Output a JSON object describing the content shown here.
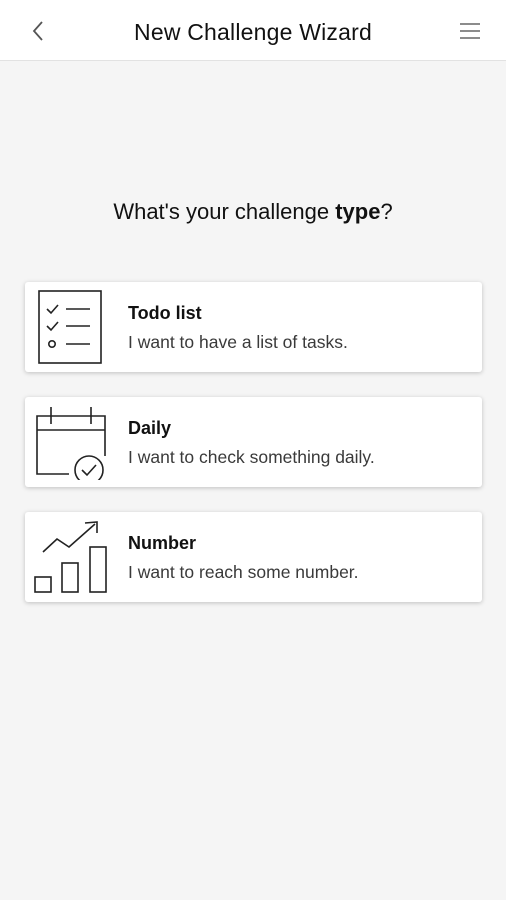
{
  "header": {
    "title": "New Challenge Wizard",
    "back_icon": "chevron-left-icon",
    "menu_icon": "hamburger-menu-icon"
  },
  "question": {
    "prefix": "What's your challenge ",
    "emphasis": "type",
    "suffix": "?"
  },
  "options": [
    {
      "title": "Todo list",
      "description": "I want to have a list of tasks.",
      "icon": "checklist-icon"
    },
    {
      "title": "Daily",
      "description": "I want to check something daily.",
      "icon": "calendar-check-icon"
    },
    {
      "title": "Number",
      "description": "I want to reach some number.",
      "icon": "growth-chart-icon"
    }
  ]
}
